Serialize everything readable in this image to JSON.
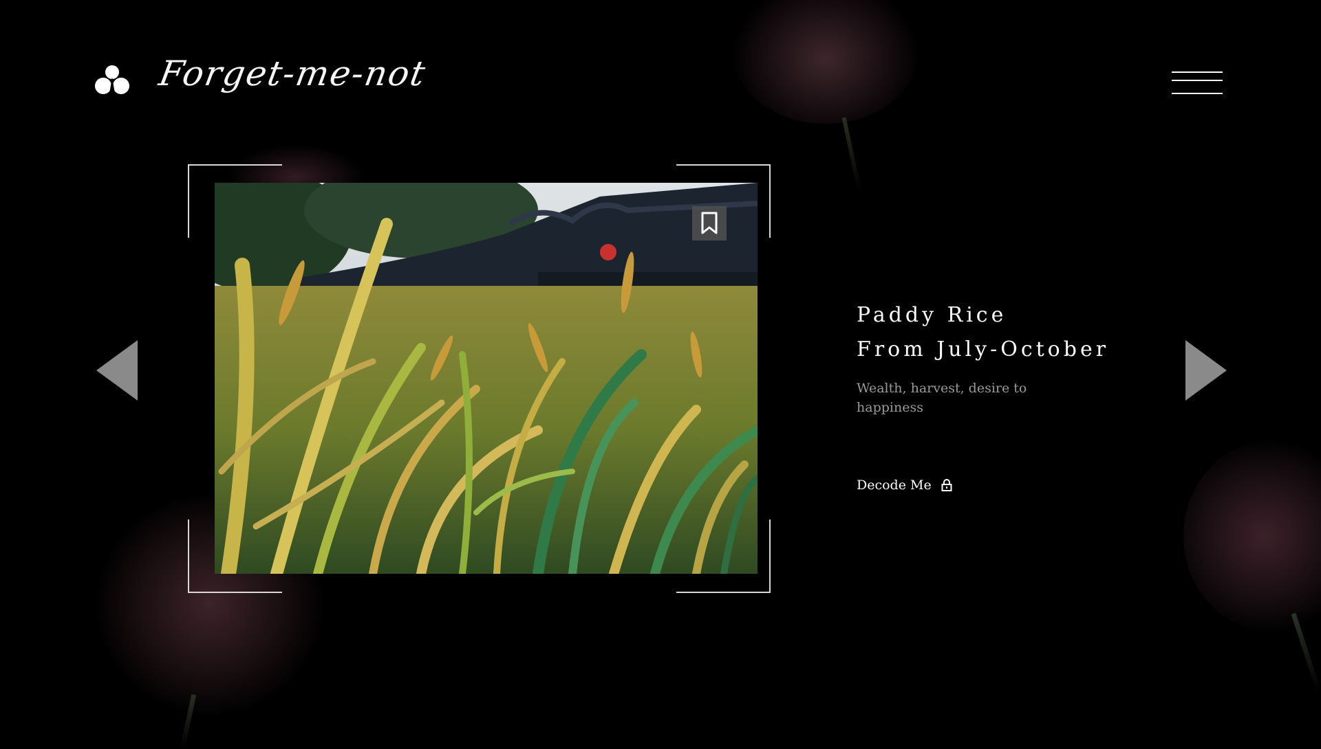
{
  "header": {
    "brand": "Forget-me-not",
    "logo_icon": "clover-drop-icon",
    "menu_icon": "hamburger-menu-icon"
  },
  "slide": {
    "title_line_1": "Paddy Rice",
    "title_line_2": "From July-October",
    "description": "Wealth, harvest, desire to happiness",
    "action_label": "Decode Me",
    "action_icon": "lock-icon",
    "photo_subject": "rice-paddy-photo",
    "bookmark_icon": "bookmark-icon"
  },
  "navigation": {
    "prev_icon": "triangle-left-icon",
    "next_icon": "triangle-right-icon"
  },
  "colors": {
    "background": "#000000",
    "text": "#ffffff",
    "muted_text": "#9a9a9a",
    "arrow": "#8a8a8a",
    "frame": "#d9d9d9"
  }
}
